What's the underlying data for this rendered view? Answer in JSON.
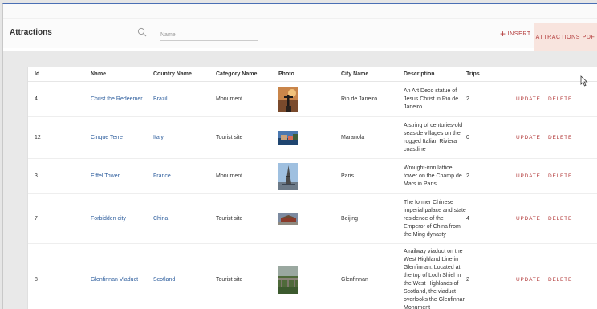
{
  "header": {
    "title": "Attractions",
    "search_placeholder": "Name",
    "insert_label": "INSERT",
    "pdf_label": "ATTRACTIONS PDF"
  },
  "table": {
    "columns": [
      "Id",
      "Name",
      "Country Name",
      "Category Name",
      "Photo",
      "City Name",
      "Description",
      "Trips"
    ],
    "update_label": "UPDATE",
    "delete_label": "DELETE",
    "rows": [
      {
        "id": "4",
        "name": "Christ the Redeemer",
        "country": "Brazil",
        "category": "Monument",
        "photo": "statue-photo",
        "city": "Rio de Janeiro",
        "description": "An Art Deco statue of Jesus Christ in Rio de Janeiro",
        "trips": "2"
      },
      {
        "id": "12",
        "name": "Cinque Terre",
        "country": "Italy",
        "category": "Tourist site",
        "photo": "coast-photo",
        "city": "Maranola",
        "description": "A string of centuries-old seaside villages on the rugged Italian Riviera coastline",
        "trips": "0"
      },
      {
        "id": "3",
        "name": "Eiffel Tower",
        "country": "France",
        "category": "Monument",
        "photo": "tower-photo",
        "city": "Paris",
        "description": "Wrought-iron lattice tower on the Champ de Mars in Paris.",
        "trips": "2"
      },
      {
        "id": "7",
        "name": "Forbidden city",
        "country": "China",
        "category": "Tourist site",
        "photo": "palace-photo",
        "city": "Beijing",
        "description": "The former Chinese imperial palace and state residence of the Emperor of China from the Ming dynasty",
        "trips": "4"
      },
      {
        "id": "8",
        "name": "Glenfinnan Viaduct",
        "country": "Scotland",
        "category": "Tourist site",
        "photo": "viaduct-photo",
        "city": "Glenfinnan",
        "description": "A railway viaduct on the West Highland Line in Glenfinnan. Located at the top of Loch Shiel in the West Highlands of Scotland, the viaduct overlooks the Glenfinnan Monument",
        "trips": "2"
      }
    ]
  },
  "colors": {
    "accent": "#b33b3b",
    "link": "#2f5f9e",
    "pdf_bg": "#f8e4de"
  }
}
